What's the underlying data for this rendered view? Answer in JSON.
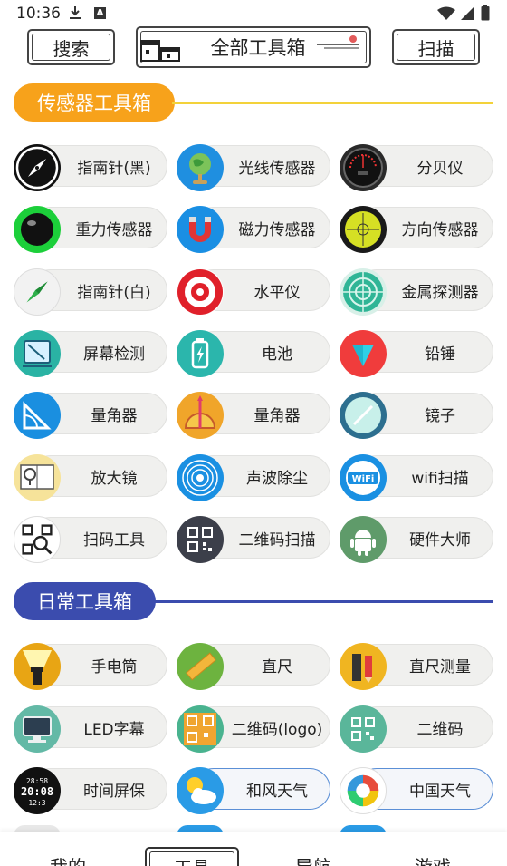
{
  "status_bar": {
    "time": "10:36",
    "a_icon": "A"
  },
  "header": {
    "search_label": "搜索",
    "all_tools_label": "全部工具箱",
    "scan_label": "扫描"
  },
  "sections": {
    "sensor": {
      "title": "传感器工具箱",
      "color": "#f7a21b",
      "line_color": "#f3d23a",
      "tools": [
        {
          "label": "指南针(黑)",
          "icon": "compass-black-icon"
        },
        {
          "label": "光线传感器",
          "icon": "light-sensor-globe-icon"
        },
        {
          "label": "分贝仪",
          "icon": "decibel-meter-icon"
        },
        {
          "label": "重力传感器",
          "icon": "gravity-ball-icon"
        },
        {
          "label": "磁力传感器",
          "icon": "magnet-icon"
        },
        {
          "label": "方向传感器",
          "icon": "direction-level-icon"
        },
        {
          "label": "指南针(白)",
          "icon": "compass-white-icon"
        },
        {
          "label": "水平仪",
          "icon": "level-target-icon"
        },
        {
          "label": "金属探测器",
          "icon": "radar-icon"
        },
        {
          "label": "屏幕检测",
          "icon": "screen-test-icon"
        },
        {
          "label": "电池",
          "icon": "battery-icon"
        },
        {
          "label": "铅锤",
          "icon": "plumb-bob-icon"
        },
        {
          "label": "量角器",
          "icon": "protractor-icon"
        },
        {
          "label": "量角器",
          "icon": "angle-ruler-icon"
        },
        {
          "label": "镜子",
          "icon": "mirror-icon"
        },
        {
          "label": "放大镜",
          "icon": "magnifier-book-icon"
        },
        {
          "label": "声波除尘",
          "icon": "sound-wave-icon"
        },
        {
          "label": "wifi扫描",
          "icon": "wifi-icon"
        },
        {
          "label": "扫码工具",
          "icon": "scan-code-icon"
        },
        {
          "label": "二维码扫描",
          "icon": "qr-scan-icon"
        },
        {
          "label": "硬件大师",
          "icon": "android-icon"
        }
      ]
    },
    "daily": {
      "title": "日常工具箱",
      "color": "#3b4cae",
      "line_color": "#3b4cae",
      "tools": [
        {
          "label": "手电筒",
          "icon": "flashlight-icon"
        },
        {
          "label": "直尺",
          "icon": "ruler-icon"
        },
        {
          "label": "直尺测量",
          "icon": "ruler-pencil-icon"
        },
        {
          "label": "LED字幕",
          "icon": "monitor-icon"
        },
        {
          "label": "二维码(logo)",
          "icon": "qr-logo-icon"
        },
        {
          "label": "二维码",
          "icon": "qr-code-icon"
        },
        {
          "label": "时间屏保",
          "icon": "clock-screen-icon"
        },
        {
          "label": "和风天气",
          "icon": "weather-sun-cloud-icon"
        },
        {
          "label": "中国天气",
          "icon": "china-weather-icon"
        }
      ],
      "clock_text_1": "28:58",
      "clock_text_2": "20:08",
      "clock_text_3": "12:3"
    }
  },
  "bottom_nav": {
    "items": [
      "我的",
      "工具",
      "导航",
      "游戏"
    ],
    "active_index": 1
  },
  "colors": {
    "pill_bg": "#f0f0ee",
    "outline_blue": "#5b8fd6"
  }
}
